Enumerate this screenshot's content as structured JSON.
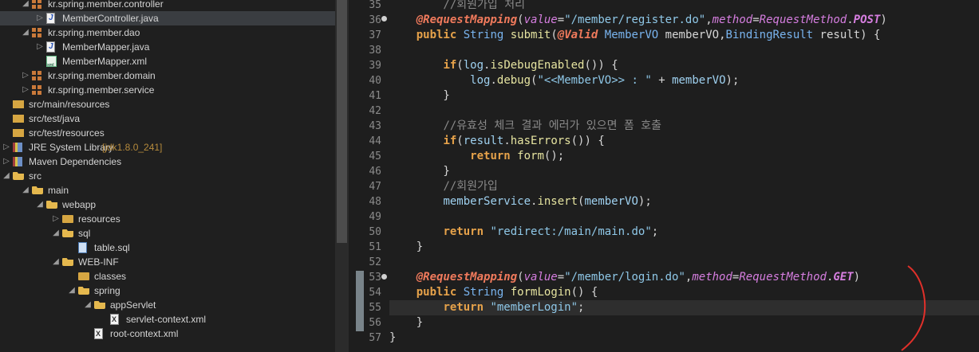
{
  "explorer": {
    "items": [
      {
        "label": "kr.spring.member.controller",
        "icon": "package-icon",
        "arrow": "down"
      },
      {
        "label": "MemberController.java",
        "icon": "java-file-icon",
        "arrow": "right",
        "selected": true
      },
      {
        "label": "kr.spring.member.dao",
        "icon": "package-icon",
        "arrow": "down"
      },
      {
        "label": "MemberMapper.java",
        "icon": "java-file-icon",
        "arrow": "right"
      },
      {
        "label": "MemberMapper.xml",
        "icon": "mapper-xml-icon",
        "arrow": ""
      },
      {
        "label": "kr.spring.member.domain",
        "icon": "package-icon",
        "arrow": "right"
      },
      {
        "label": "kr.spring.member.service",
        "icon": "package-icon",
        "arrow": "right"
      },
      {
        "label": "src/main/resources",
        "icon": "source-folder-icon",
        "arrow": ""
      },
      {
        "label": "src/test/java",
        "icon": "source-folder-icon",
        "arrow": ""
      },
      {
        "label": "src/test/resources",
        "icon": "source-folder-icon",
        "arrow": ""
      },
      {
        "label": "JRE System Library",
        "decoration": "[jdk1.8.0_241]",
        "icon": "library-icon",
        "arrow": "right"
      },
      {
        "label": "Maven Dependencies",
        "icon": "library-icon",
        "arrow": "right"
      },
      {
        "label": "src",
        "icon": "folder-open-icon",
        "arrow": "down"
      },
      {
        "label": "main",
        "icon": "folder-open-icon",
        "arrow": "down"
      },
      {
        "label": "webapp",
        "icon": "folder-open-icon",
        "arrow": "down"
      },
      {
        "label": "resources",
        "icon": "folder-icon",
        "arrow": "right"
      },
      {
        "label": "sql",
        "icon": "folder-open-icon",
        "arrow": "down"
      },
      {
        "label": "table.sql",
        "icon": "sql-file-icon",
        "arrow": ""
      },
      {
        "label": "WEB-INF",
        "icon": "folder-open-icon",
        "arrow": "down"
      },
      {
        "label": "classes",
        "icon": "folder-icon",
        "arrow": ""
      },
      {
        "label": "spring",
        "icon": "folder-open-icon",
        "arrow": "down"
      },
      {
        "label": "appServlet",
        "icon": "folder-open-icon",
        "arrow": "down"
      },
      {
        "label": "servlet-context.xml",
        "icon": "xml-file-icon",
        "arrow": ""
      },
      {
        "label": "root-context.xml",
        "icon": "xml-file-icon",
        "arrow": ""
      }
    ]
  },
  "editor": {
    "line_numbers": [
      "35",
      "36",
      "37",
      "38",
      "39",
      "40",
      "41",
      "42",
      "43",
      "44",
      "45",
      "46",
      "47",
      "48",
      "49",
      "50",
      "51",
      "52",
      "53",
      "54",
      "55",
      "56",
      "57"
    ],
    "current_line": "55",
    "colors": {
      "keyword": "#e6a24a",
      "annotation": "#f07a5c",
      "string": "#8fc8e8",
      "comment": "#8a8a8a",
      "enum": "#d67ee0"
    },
    "tokens": {
      "l35_comment": "        //회원가입 처리",
      "l36_annot": "@RequestMapping",
      "l36_attr_value": "value",
      "l36_str": "\"/member/register.do\"",
      "l36_attr_method": "method",
      "l36_enum_type": "RequestMethod",
      "l36_enum_val": "POST",
      "l37_public": "public",
      "l37_type": "String",
      "l37_method": "submit",
      "l37_valid": "@Valid",
      "l37_vo": "MemberVO",
      "l37_param1": "memberVO",
      "l37_br": "BindingResult",
      "l37_param2": "result",
      "l39_if": "if",
      "l39_log": "log",
      "l39_call": "isDebugEnabled",
      "l40_log": "log",
      "l40_call": "debug",
      "l40_str": "\"<<MemberVO>> : \"",
      "l40_var": "memberVO",
      "l43_comment": "//유효성 체크 결과 에러가 있으면 폼 호출",
      "l44_if": "if",
      "l44_var": "result",
      "l44_call": "hasErrors",
      "l45_return": "return",
      "l45_call": "form",
      "l47_comment": "//회원가입",
      "l48_var": "memberService",
      "l48_call": "insert",
      "l48_arg": "memberVO",
      "l50_return": "return",
      "l50_str": "\"redirect:/main/main.do\"",
      "l53_annot": "@RequestMapping",
      "l53_attr_value": "value",
      "l53_str": "\"/member/login.do\"",
      "l53_attr_method": "method",
      "l53_enum_type": "RequestMethod",
      "l53_enum_val": "GET",
      "l54_public": "public",
      "l54_type": "String",
      "l54_method": "formLogin",
      "l55_return": "return",
      "l55_str": "\"memberLogin\""
    }
  }
}
